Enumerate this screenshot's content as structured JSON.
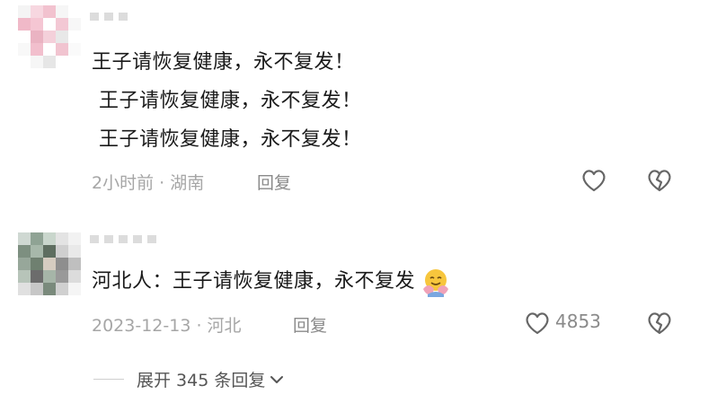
{
  "comments": [
    {
      "lines": [
        "王子请恢复健康，永不复发！",
        "王子请恢复健康，永不复发！",
        "王子请恢复健康，永不复发！"
      ],
      "meta": "2小时前 · 湖南",
      "reply_label": "回复"
    },
    {
      "lines": [
        "河北人：王子请恢复健康，永不复发"
      ],
      "emoji": "hugging-face-icon",
      "meta": "2023-12-13 · 河北",
      "reply_label": "回复",
      "like_count": "4853"
    }
  ],
  "expand": {
    "label": "展开 345 条回复"
  },
  "colors": {
    "text": "#1a1a1a",
    "meta": "#a6a6a6",
    "icon": "#666666"
  }
}
